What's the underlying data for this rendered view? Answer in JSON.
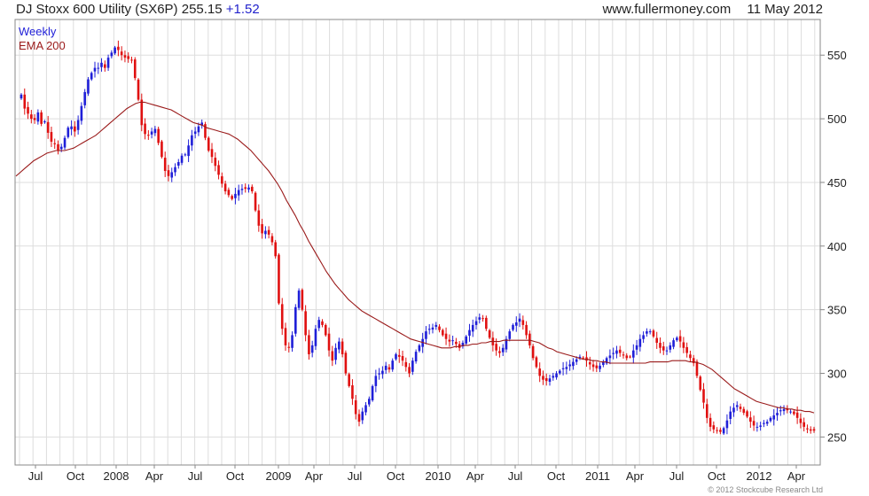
{
  "header": {
    "title": "DJ Stoxx 600 Utility (SX6P) 255.15",
    "change": "+1.52",
    "website": "www.fullermoney.com",
    "date": "11 May 2012"
  },
  "copyright": "© 2012 Stockcube Research Ltd",
  "colors": {
    "up": "#1f1fd8",
    "down": "#e01010",
    "ema": "#9a1a1a",
    "legend_weekly": "#1f1fd8",
    "legend_ema": "#9a1a1a"
  },
  "chart_data": {
    "type": "candlestick",
    "frequency": "Weekly",
    "legend": [
      "Weekly",
      "EMA 200"
    ],
    "legend_placement": "top-left",
    "x_tick_labels": [
      "Jul",
      "Oct",
      "2008",
      "Apr",
      "Jul",
      "Oct",
      "2009",
      "Apr",
      "Jul",
      "Oct",
      "2010",
      "Apr",
      "Jul",
      "Oct",
      "2011",
      "Apr",
      "Jul",
      "Oct",
      "2012",
      "Apr"
    ],
    "y_ticks": [
      250,
      300,
      350,
      400,
      450,
      500,
      550
    ],
    "ylim": [
      228,
      578
    ],
    "y_axis_position": "right",
    "grid": true,
    "closes": [
      519,
      508,
      504,
      500,
      499,
      505,
      496,
      498,
      489,
      482,
      480,
      475,
      478,
      485,
      493,
      494,
      490,
      499,
      510,
      521,
      531,
      536,
      540,
      540,
      544,
      540,
      548,
      552,
      556,
      554,
      550,
      548,
      547,
      546,
      532,
      515,
      495,
      488,
      487,
      490,
      492,
      481,
      470,
      459,
      455,
      458,
      462,
      466,
      471,
      472,
      479,
      487,
      490,
      494,
      497,
      485,
      475,
      470,
      463,
      456,
      449,
      443,
      440,
      437,
      441,
      444,
      445,
      445,
      446,
      443,
      428,
      416,
      410,
      412,
      409,
      403,
      392,
      355,
      335,
      322,
      320,
      330,
      352,
      365,
      350,
      330,
      315,
      322,
      335,
      342,
      338,
      330,
      318,
      310,
      320,
      325,
      315,
      300,
      290,
      280,
      268,
      262,
      270,
      275,
      280,
      290,
      298,
      300,
      302,
      306,
      303,
      310,
      315,
      313,
      310,
      305,
      300,
      310,
      317,
      322,
      327,
      333,
      335,
      336,
      338,
      334,
      330,
      327,
      325,
      326,
      323,
      320,
      324,
      329,
      334,
      338,
      341,
      344,
      343,
      335,
      328,
      322,
      318,
      316,
      320,
      327,
      333,
      338,
      340,
      343,
      338,
      330,
      322,
      312,
      305,
      298,
      295,
      294,
      296,
      298,
      300,
      302,
      304,
      305,
      307,
      309,
      311,
      313,
      312,
      310,
      307,
      305,
      304,
      306,
      309,
      312,
      314,
      316,
      318,
      316,
      314,
      312,
      313,
      318,
      322,
      327,
      330,
      333,
      333,
      329,
      324,
      320,
      318,
      318,
      322,
      326,
      328,
      325,
      320,
      316,
      312,
      308,
      298,
      287,
      277,
      265,
      258,
      256,
      255,
      254,
      257,
      263,
      270,
      273,
      275,
      272,
      269,
      266,
      262,
      259,
      258,
      259,
      261,
      262,
      265,
      267,
      269,
      271,
      272,
      271,
      270,
      268,
      265,
      261,
      258,
      256,
      255,
      255
    ],
    "ema_200": [
      455,
      458,
      461,
      464,
      467,
      469,
      471,
      473,
      474,
      475,
      475,
      475,
      476,
      477,
      479,
      481,
      483,
      485,
      487,
      490,
      493,
      496,
      499,
      502,
      505,
      508,
      510,
      512,
      513,
      513,
      512,
      511,
      510,
      509,
      508,
      507,
      505,
      503,
      501,
      499,
      497,
      496,
      495,
      493,
      492,
      491,
      490,
      489,
      488,
      486,
      484,
      481,
      478,
      475,
      471,
      467,
      463,
      459,
      454,
      449,
      443,
      436,
      430,
      424,
      417,
      411,
      404,
      398,
      392,
      386,
      380,
      375,
      370,
      366,
      362,
      358,
      355,
      352,
      349,
      347,
      345,
      343,
      341,
      339,
      337,
      335,
      333,
      331,
      329,
      327,
      326,
      325,
      324,
      323,
      322,
      321,
      320,
      320,
      320,
      321,
      321,
      322,
      322,
      323,
      323,
      324,
      324,
      325,
      325,
      325,
      326,
      326,
      326,
      326,
      326,
      326,
      326,
      325,
      324,
      322,
      320,
      319,
      317,
      316,
      315,
      314,
      313,
      312,
      311,
      311,
      310,
      310,
      309,
      309,
      308,
      308,
      308,
      308,
      308,
      308,
      308,
      308,
      308,
      309,
      309,
      309,
      309,
      309,
      310,
      310,
      310,
      310,
      309,
      309,
      308,
      307,
      305,
      303,
      300,
      297,
      294,
      291,
      288,
      286,
      284,
      282,
      280,
      278,
      277,
      276,
      275,
      274,
      273,
      273,
      272,
      272,
      271,
      271,
      270,
      270,
      269
    ]
  }
}
